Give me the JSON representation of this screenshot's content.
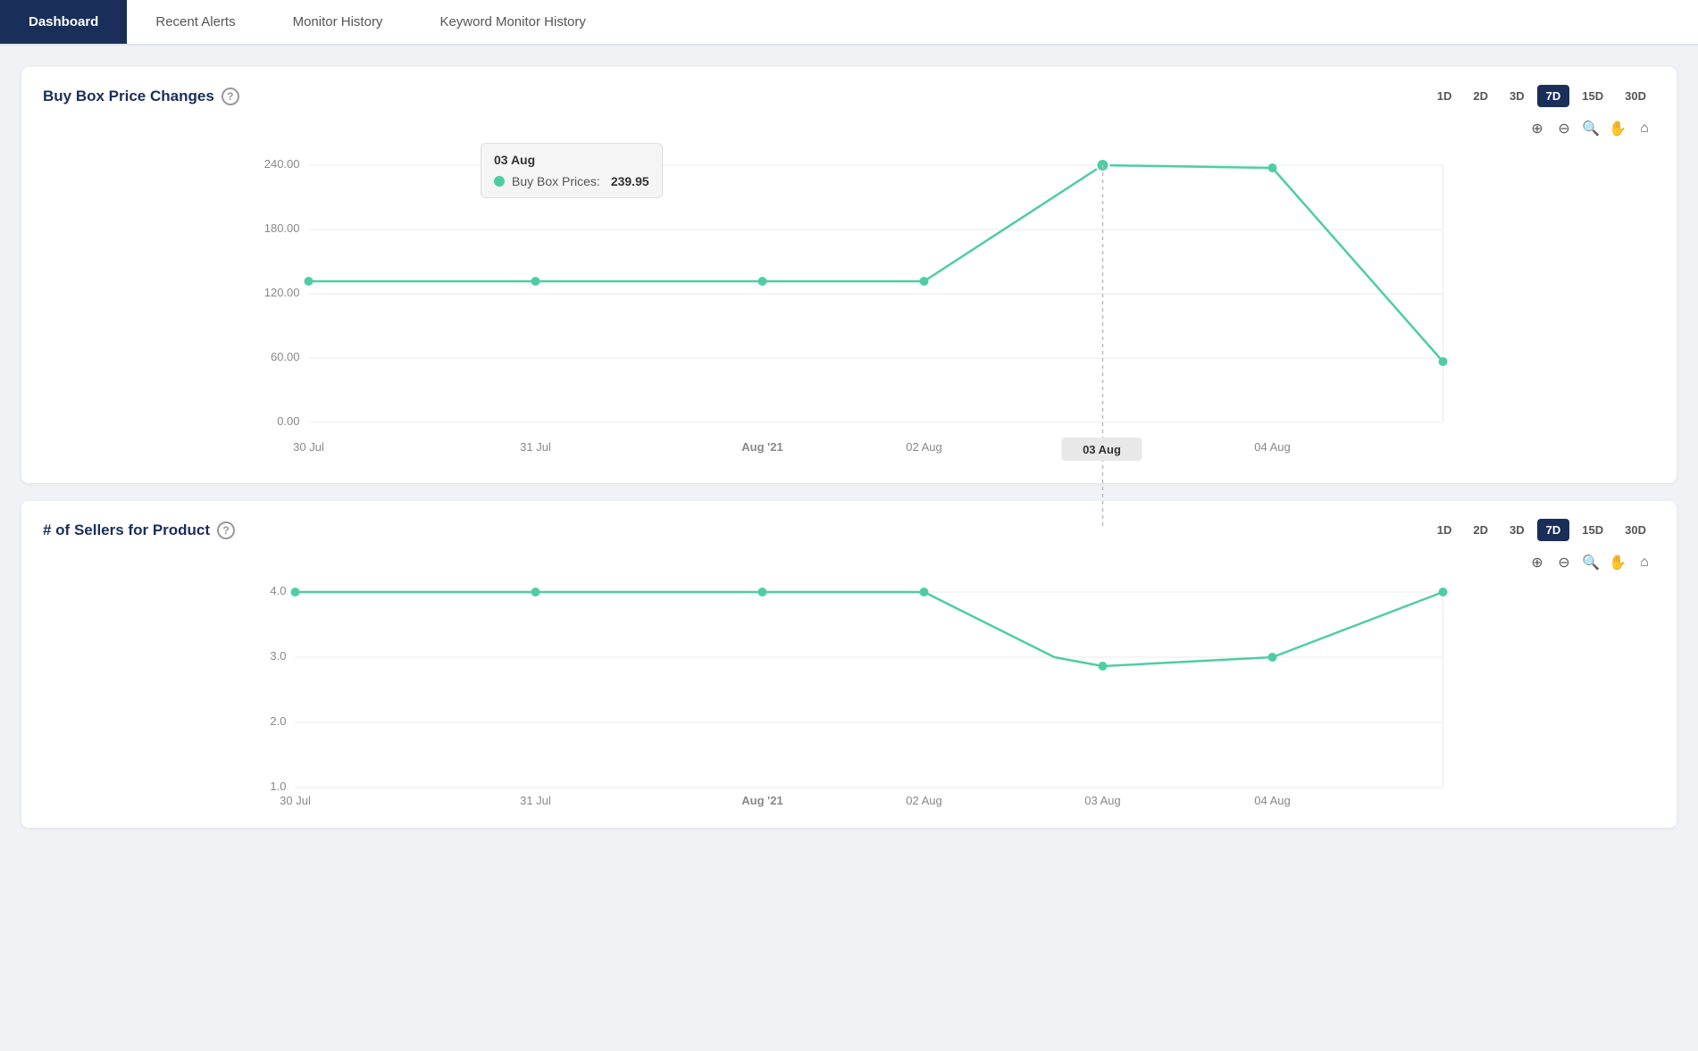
{
  "nav": {
    "tabs": [
      {
        "label": "Dashboard",
        "active": false
      },
      {
        "label": "Recent Alerts",
        "active": false
      },
      {
        "label": "Monitor History",
        "active": true
      },
      {
        "label": "Keyword Monitor History",
        "active": false
      }
    ]
  },
  "chart1": {
    "title": "Buy Box Price Changes",
    "help": "?",
    "periods": [
      "1D",
      "2D",
      "3D",
      "7D",
      "15D",
      "30D"
    ],
    "active_period": "7D",
    "tooltip": {
      "date": "03 Aug",
      "label": "Buy Box Prices:",
      "value": "239.95"
    },
    "y_labels": [
      "240.00",
      "180.00",
      "120.00",
      "60.00",
      "0.00"
    ],
    "x_labels": [
      "30 Jul",
      "31 Jul",
      "Aug '21",
      "02 Aug",
      "03 Aug",
      "04 Aug"
    ],
    "highlighted_x": "03 Aug"
  },
  "chart2": {
    "title": "# of Sellers for Product",
    "help": "?",
    "periods": [
      "1D",
      "2D",
      "3D",
      "7D",
      "15D",
      "30D"
    ],
    "active_period": "7D",
    "y_labels": [
      "4.0",
      "3.0",
      "2.0",
      "1.0"
    ],
    "x_labels": [
      "30 Jul",
      "31 Jul",
      "Aug '21",
      "02 Aug",
      "03 Aug",
      "04 Aug"
    ]
  },
  "icons": {
    "zoom_in": "+",
    "zoom_out": "−",
    "zoom_fit": "⊕",
    "pan": "✋",
    "home": "⌂",
    "question": "?"
  }
}
